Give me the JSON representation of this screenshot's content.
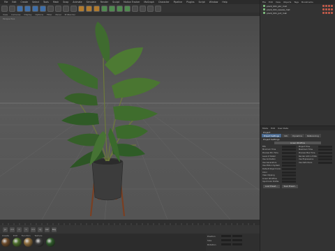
{
  "menubar": {
    "items": [
      "File",
      "Edit",
      "Create",
      "Select",
      "Tools",
      "Mesh",
      "Snap",
      "Animate",
      "Simulate",
      "Render",
      "Sculpt",
      "Motion Tracker",
      "MoGraph",
      "Character",
      "Pipeline",
      "Plugins",
      "Script",
      "Window",
      "Help"
    ]
  },
  "toolbar": {
    "buttons": [
      "undo",
      "redo",
      "select",
      "move",
      "scale",
      "rotate",
      "x-axis",
      "y-axis",
      "z-axis",
      "coord",
      "render-view",
      "render",
      "render-settings",
      "cube",
      "pen",
      "subdivision",
      "array",
      "deformer",
      "floor",
      "camera",
      "light"
    ]
  },
  "viewport": {
    "menu": [
      "View",
      "Cameras",
      "Display",
      "Options",
      "Filter",
      "Panel",
      "ProRender"
    ],
    "label": "Perspective"
  },
  "objects": {
    "menu": [
      "File",
      "Edit",
      "View",
      "Objects",
      "Tags",
      "Bookmarks"
    ],
    "rows": [
      {
        "name": "plant_001_pbr_mat",
        "selected": false
      },
      {
        "name": "plant_001_leaves_mat",
        "selected": false
      },
      {
        "name": "plant_001_pot_mat",
        "selected": false
      }
    ]
  },
  "attributes": {
    "menu": [
      "Mode",
      "Edit",
      "User Data"
    ],
    "title": "Project",
    "tabs": [
      "Project Settings",
      "Info",
      "Dynamics",
      "Referencing"
    ],
    "active_tab": "Project Settings",
    "section": "Project Settings",
    "top_field": "Linear Workflow",
    "left_rows": [
      "FPS",
      "Minimum Time",
      "Preview Min Time",
      "Level of Detail",
      "Use Animation",
      "Use Generators",
      "Use Motion System",
      "Default Object Color",
      "Color",
      "View Clipping",
      "Linear Workflow",
      "Input Color Profile"
    ],
    "right_rows": [
      "Project Time",
      "Maximum Time",
      "Preview Max Time",
      "Render LOD in Editor",
      "Use Expressions",
      "Use Deformers",
      "",
      "",
      "",
      "",
      "",
      ""
    ],
    "buttons": [
      "Load Preset...",
      "Save Preset..."
    ]
  },
  "timeline": {
    "buttons": [
      "|<",
      "<<",
      "<",
      ">",
      ">>",
      ">|",
      "rec",
      "key"
    ]
  },
  "materials": {
    "menu": [
      "Create",
      "Edit",
      "Function",
      "Texture"
    ],
    "swatches": [
      "#6b4a2a",
      "#4a6b2a",
      "#8a6a3a",
      "#3a3a3a",
      "#2f5a2a"
    ]
  },
  "coords": {
    "labels": [
      "Position",
      "Size",
      "Rotation"
    ]
  }
}
